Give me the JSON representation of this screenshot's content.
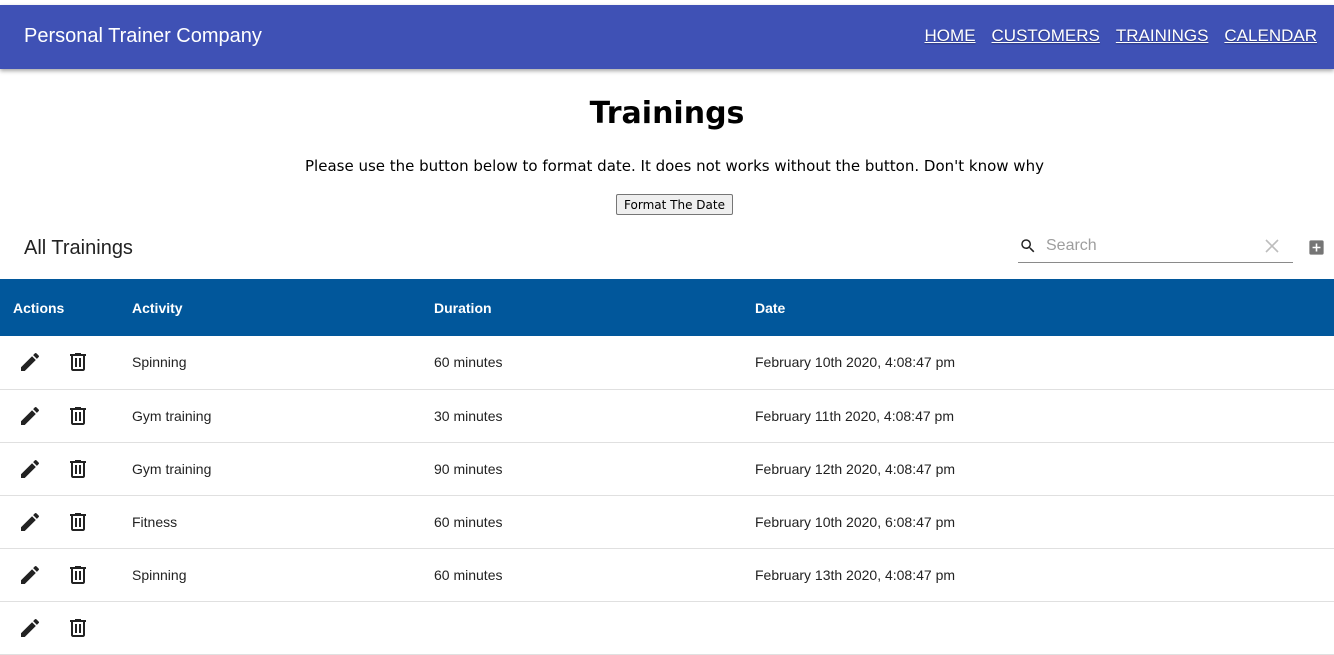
{
  "appbar": {
    "brand": "Personal Trainer Company",
    "nav": [
      "HOME",
      "CUSTOMERS",
      "TRAININGS",
      "CALENDAR"
    ]
  },
  "page": {
    "title": "Trainings",
    "note": "Please use the button below to format date. It does not works without the button. Don't know why",
    "format_button": "Format The Date"
  },
  "table": {
    "title": "All Trainings",
    "search_placeholder": "Search",
    "columns": [
      "Actions",
      "Activity",
      "Duration",
      "Date"
    ],
    "rows": [
      {
        "activity": "Spinning",
        "duration": "60 minutes",
        "date": "February 10th 2020, 4:08:47 pm"
      },
      {
        "activity": "Gym training",
        "duration": "30 minutes",
        "date": "February 11th 2020, 4:08:47 pm"
      },
      {
        "activity": "Gym training",
        "duration": "90 minutes",
        "date": "February 12th 2020, 4:08:47 pm"
      },
      {
        "activity": "Fitness",
        "duration": "60 minutes",
        "date": "February 10th 2020, 6:08:47 pm"
      },
      {
        "activity": "Spinning",
        "duration": "60 minutes",
        "date": "February 13th 2020, 4:08:47 pm"
      }
    ]
  },
  "icons": {
    "edit": "edit-icon",
    "delete": "delete-icon",
    "search": "search-icon",
    "clear": "close-icon",
    "add": "add-box-icon"
  },
  "colors": {
    "appbar": "#3f51b5",
    "table_header": "#01579b"
  }
}
